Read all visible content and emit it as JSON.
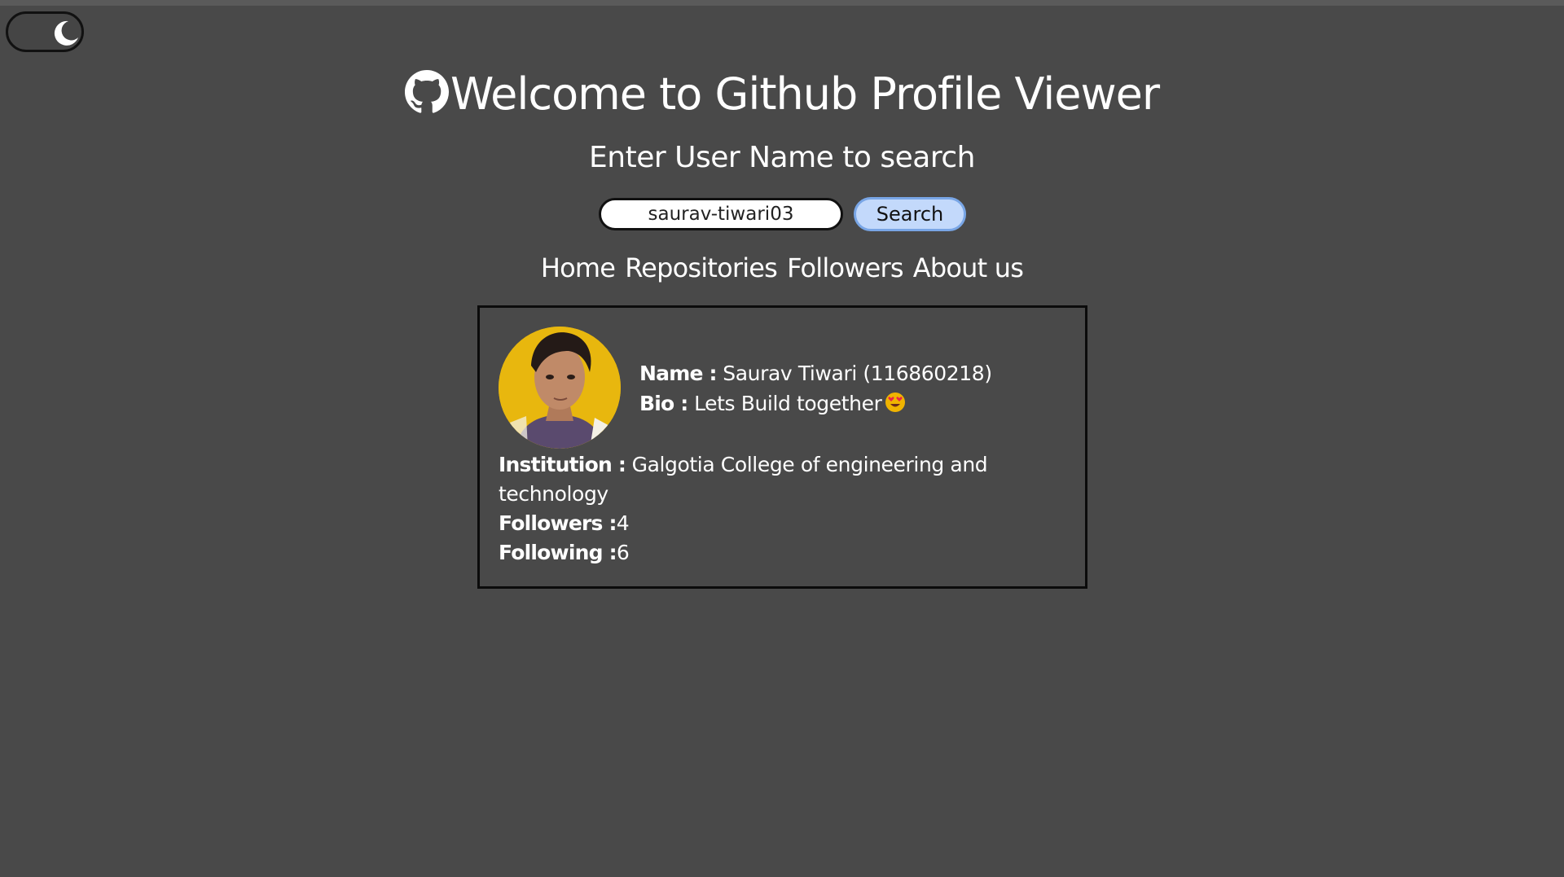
{
  "header": {
    "title": "Welcome to Github Profile Viewer",
    "subtitle": "Enter User Name to search"
  },
  "theme_toggle": {
    "icon": "moon-icon"
  },
  "search": {
    "value": "saurav-tiwari03",
    "button_label": "Search"
  },
  "nav": {
    "items": [
      {
        "label": "Home"
      },
      {
        "label": "Repositories"
      },
      {
        "label": "Followers"
      },
      {
        "label": "About us"
      }
    ]
  },
  "profile": {
    "name_label": "Name :",
    "name_value": "Saurav Tiwari (116860218)",
    "bio_label": "Bio :",
    "bio_value": "Lets Build together",
    "bio_emoji": "smiling-face-with-heart-eyes-icon",
    "institution_label": "Institution :",
    "institution_value": "Galgotia College of engineering and technology",
    "followers_label": "Followers :",
    "followers_value": "4",
    "following_label": "Following :",
    "following_value": "6"
  },
  "colors": {
    "background": "#494949",
    "search_button_bg": "#c3d9fb",
    "search_button_border": "#79a6e6",
    "avatar_bg": "#e8b70e"
  }
}
